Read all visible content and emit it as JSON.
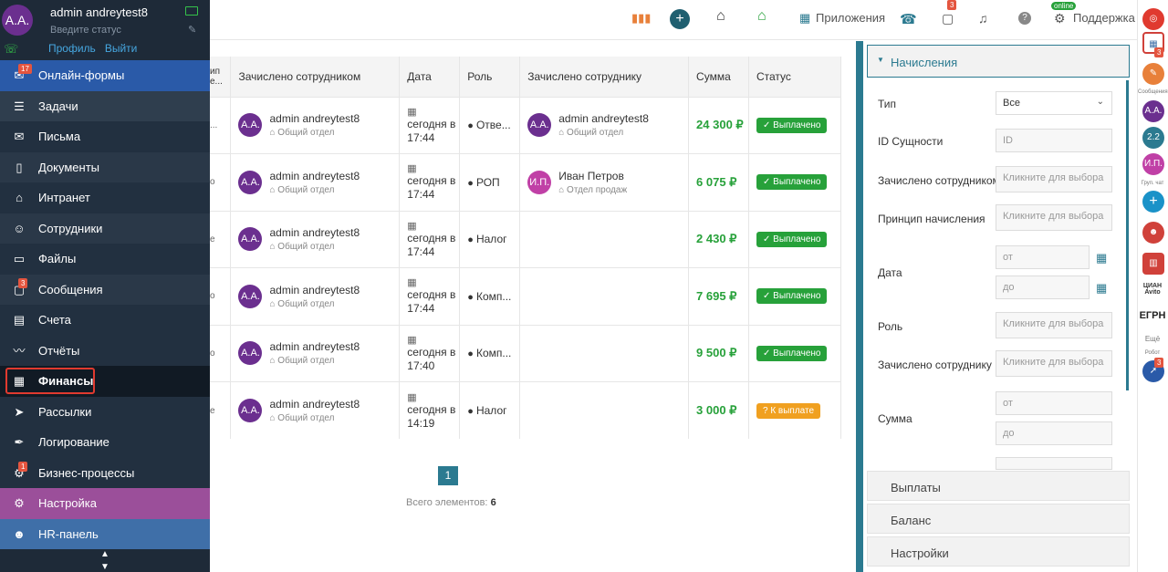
{
  "profile": {
    "initials": "А.А.",
    "name": "admin andreytest8",
    "status_placeholder": "Введите статус",
    "profile_link": "Профиль",
    "logout_link": "Выйти"
  },
  "menu": [
    {
      "label": "Онлайн-формы",
      "badge": "17"
    },
    {
      "label": "Задачи"
    },
    {
      "label": "Письма"
    },
    {
      "label": "Документы"
    },
    {
      "label": "Интранет"
    },
    {
      "label": "Сотрудники"
    },
    {
      "label": "Файлы"
    },
    {
      "label": "Сообщения",
      "badge": "3"
    },
    {
      "label": "Счета"
    },
    {
      "label": "Отчёты"
    },
    {
      "label": "Финансы"
    },
    {
      "label": "Рассылки"
    },
    {
      "label": "Логирование"
    },
    {
      "label": "Бизнес-процессы",
      "badge": "1"
    },
    {
      "label": "Настройка"
    },
    {
      "label": "HR-панель"
    }
  ],
  "topbar": {
    "apps": "Приложения",
    "support": "Поддержка",
    "online": "online",
    "chat_badge": "3"
  },
  "table": {
    "columns": [
      "ип е...",
      "Зачислено сотрудником",
      "Дата",
      "Роль",
      "Зачислено сотруднику",
      "Сумма",
      "Статус"
    ],
    "rows": [
      {
        "type": "...",
        "by_initials": "А.А.",
        "by_name": "admin andreytest8",
        "by_dept": "Общий отдел",
        "date": "сегодня в 17:44",
        "role": "Отве...",
        "to_initials": "А.А.",
        "to_name": "admin andreytest8",
        "to_dept": "Общий отдел",
        "sum": "24 300 ₽",
        "status": "Выплачено"
      },
      {
        "type": "о",
        "by_initials": "А.А.",
        "by_name": "admin andreytest8",
        "by_dept": "Общий отдел",
        "date": "сегодня в 17:44",
        "role": "РОП",
        "to_initials": "И.П.",
        "to_name": "Иван Петров",
        "to_dept": "Отдел продаж",
        "sum": "6 075 ₽",
        "status": "Выплачено"
      },
      {
        "type": "е",
        "by_initials": "А.А.",
        "by_name": "admin andreytest8",
        "by_dept": "Общий отдел",
        "date": "сегодня в 17:44",
        "role": "Налог",
        "to_initials": "",
        "to_name": "",
        "to_dept": "",
        "sum": "2 430 ₽",
        "status": "Выплачено"
      },
      {
        "type": "о",
        "by_initials": "А.А.",
        "by_name": "admin andreytest8",
        "by_dept": "Общий отдел",
        "date": "сегодня в 17:44",
        "role": "Комп...",
        "to_initials": "",
        "to_name": "",
        "to_dept": "",
        "sum": "7 695 ₽",
        "status": "Выплачено"
      },
      {
        "type": "о",
        "by_initials": "А.А.",
        "by_name": "admin andreytest8",
        "by_dept": "Общий отдел",
        "date": "сегодня в 17:40",
        "role": "Комп...",
        "to_initials": "",
        "to_name": "",
        "to_dept": "",
        "sum": "9 500 ₽",
        "status": "Выплачено"
      },
      {
        "type": "е",
        "by_initials": "А.А.",
        "by_name": "admin andreytest8",
        "by_dept": "Общий отдел",
        "date": "сегодня в 14:19",
        "role": "Налог",
        "to_initials": "",
        "to_name": "",
        "to_dept": "",
        "sum": "3 000 ₽",
        "status": "К выплате"
      }
    ]
  },
  "pagination": {
    "page": "1",
    "total_label": "Всего элементов:",
    "total": "6"
  },
  "filters": {
    "header": "Начисления",
    "type_label": "Тип",
    "type_value": "Все",
    "id_label": "ID Сущности",
    "id_placeholder": "ID",
    "by_label": "Зачислено сотрудником",
    "by_placeholder": "Кликните для выбора",
    "principle_label": "Принцип начисления",
    "principle_placeholder": "Кликните для выбора",
    "date_label": "Дата",
    "date_from": "от",
    "date_to": "до",
    "role_label": "Роль",
    "role_placeholder": "Кликните для выбора",
    "to_label": "Зачислено сотруднику",
    "to_placeholder": "Кликните для выбора",
    "sum_label": "Сумма",
    "sum_from": "от",
    "sum_to": "до",
    "sections": [
      "Выплаты",
      "Баланс",
      "Настройки"
    ]
  },
  "right_panel": {
    "badge1": "3",
    "messages": "Сообщения",
    "user1": "А.А.",
    "user2": "2.2",
    "user3": "И.П.",
    "group_chat": "Груп. чат",
    "egrn": "ЕГРН",
    "cian": "ЦИАН Avito",
    "more": "Ещё",
    "robot": "Робот",
    "badge2": "3"
  }
}
